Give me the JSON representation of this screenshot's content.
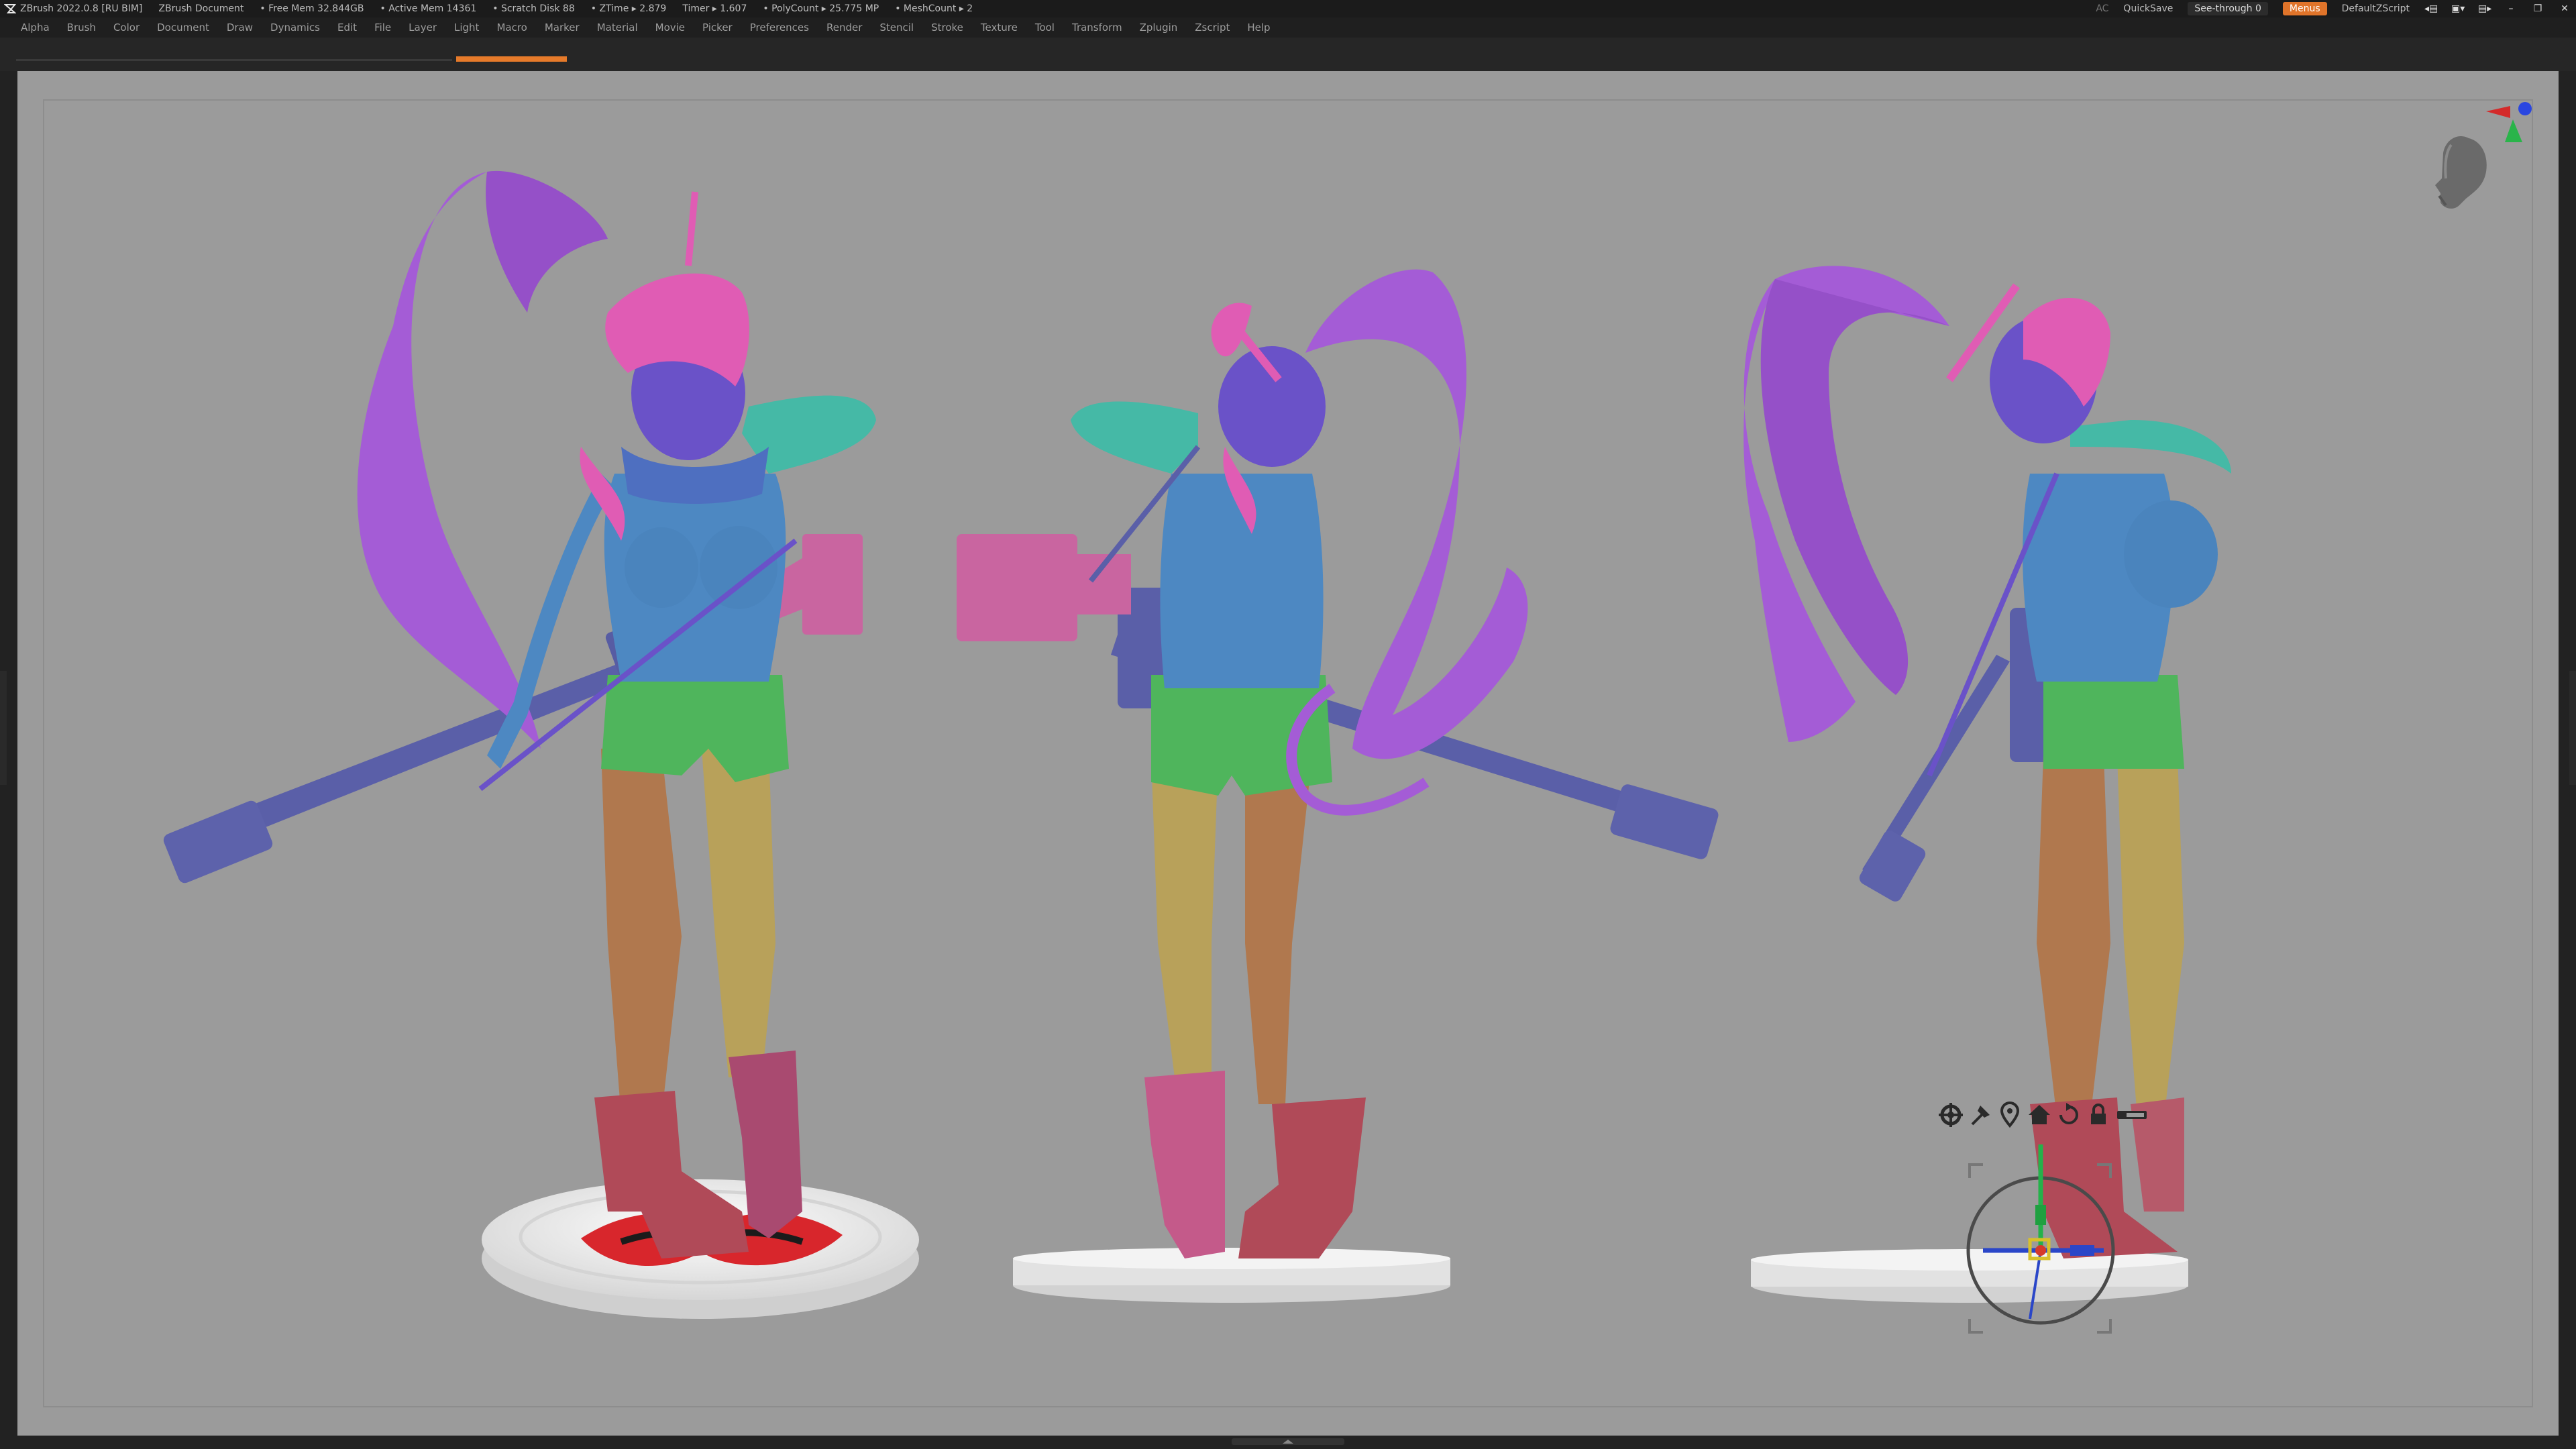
{
  "titlebar": {
    "app_title": "ZBrush 2022.0.8 [RU BIM]",
    "document": "ZBrush Document",
    "free_mem": "• Free Mem 32.844GB",
    "active_mem": "• Active Mem 14361",
    "scratch_disk": "• Scratch Disk 88",
    "ztime": "• ZTime ▸ 2.879",
    "timer": "Timer ▸ 1.607",
    "polycount": "• PolyCount ▸ 25.775 MP",
    "meshcount": "• MeshCount ▸ 2",
    "ac": "AC",
    "quicksave": "QuickSave",
    "see_through": "See-through 0",
    "menus": "Menus",
    "script": "DefaultZScript"
  },
  "menu": [
    "Alpha",
    "Brush",
    "Color",
    "Document",
    "Draw",
    "Dynamics",
    "Edit",
    "File",
    "Layer",
    "Light",
    "Macro",
    "Marker",
    "Material",
    "Movie",
    "Picker",
    "Preferences",
    "Render",
    "Stencil",
    "Stroke",
    "Texture",
    "Tool",
    "Transform",
    "Zplugin",
    "Zscript",
    "Help"
  ],
  "colors": {
    "accent": "#e67a2a",
    "canvas": "#9b9b9b",
    "hair_purple": "#a45cd6",
    "hair_pink": "#e05cb4",
    "skin_blue": "#4d88c2",
    "teal": "#45b9a6",
    "shorts_green": "#4fb55c",
    "leg_brown": "#b0784e",
    "leg_khaki": "#b8a15a",
    "boot_red": "#b04a58",
    "boot_pink": "#c45a8a",
    "rifle_blue": "#5a5fa8",
    "rifle_pink": "#c965a0",
    "base_white": "#ececec"
  },
  "icons": {
    "gizmo_settings": "gear-icon",
    "gizmo_pin": "pin-icon",
    "gizmo_location": "location-icon",
    "gizmo_home": "home-icon",
    "gizmo_reset": "reset-icon",
    "gizmo_lock": "lock-icon",
    "gizmo_toggle": "toggle-icon",
    "navigation_cube": "head-icon"
  }
}
